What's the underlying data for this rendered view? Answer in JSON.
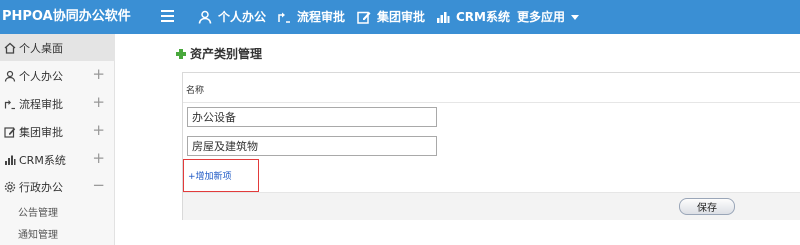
{
  "header": {
    "brand": "PHPOA协同办公软件",
    "nav": [
      {
        "label": "个人办公",
        "icon": "user-icon"
      },
      {
        "label": "流程审批",
        "icon": "workflow-icon"
      },
      {
        "label": "集团审批",
        "icon": "edit-icon"
      },
      {
        "label": "CRM系统",
        "icon": "bar-chart-icon"
      },
      {
        "label": "更多应用",
        "icon": "caret-down-icon"
      }
    ]
  },
  "sidebar": {
    "items": [
      {
        "label": "个人桌面",
        "icon": "home-icon",
        "toggle": ""
      },
      {
        "label": "个人办公",
        "icon": "user-icon",
        "toggle": "+"
      },
      {
        "label": "流程审批",
        "icon": "workflow-icon",
        "toggle": "+"
      },
      {
        "label": "集团审批",
        "icon": "edit-icon",
        "toggle": "+"
      },
      {
        "label": "CRM系统",
        "icon": "bar-chart-icon",
        "toggle": "+"
      },
      {
        "label": "行政办公",
        "icon": "gear-icon",
        "toggle": "−"
      }
    ],
    "subitems": [
      {
        "label": "公告管理"
      },
      {
        "label": "通知管理"
      }
    ]
  },
  "main": {
    "title": "资产类别管理",
    "column_header": "名称",
    "rows": [
      {
        "value": "办公设备"
      },
      {
        "value": "房屋及建筑物"
      }
    ],
    "add_link": "+增加新项",
    "save_label": "保存"
  },
  "colors": {
    "header_bg": "#3a8fd4",
    "accent_green": "#49a83c",
    "highlight_red": "#e23b3b"
  }
}
